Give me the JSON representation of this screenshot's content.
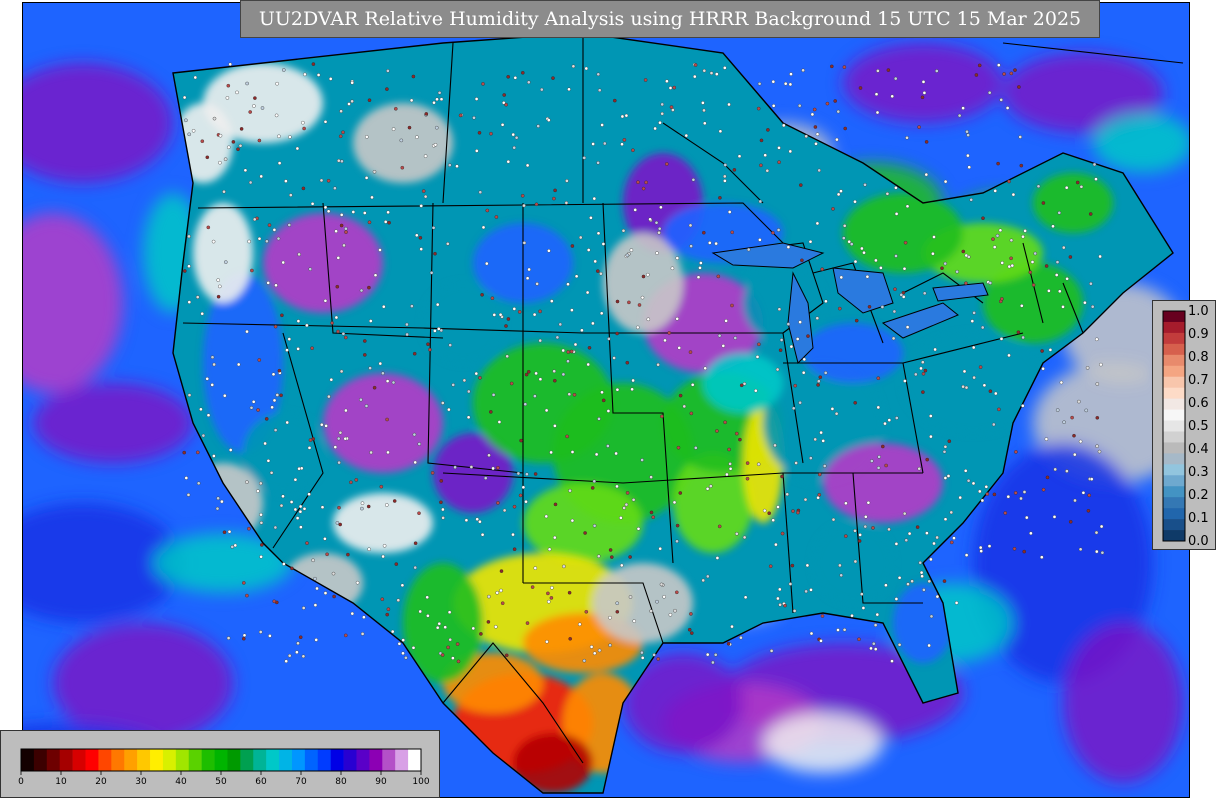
{
  "title": "UU2DVAR Relative Humidity Analysis using HRRR Background 15 UTC 15 Mar 2025",
  "rh_legend": {
    "labels": [
      "1.0",
      "0.9",
      "0.8",
      "0.7",
      "0.6",
      "0.5",
      "0.4",
      "0.3",
      "0.2",
      "0.1",
      "0.0"
    ],
    "colors": [
      "#67001f",
      "#a51c2c",
      "#c23c3c",
      "#d6604d",
      "#e88a6c",
      "#f4a582",
      "#f8c6ac",
      "#fddbc7",
      "#f2e8e4",
      "#f7f7f7",
      "#e6e6e6",
      "#d1d1d1",
      "#bababa",
      "#a6b9c8",
      "#92c5de",
      "#6ea9cf",
      "#4393c3",
      "#3478b4",
      "#2166ac",
      "#184f8a",
      "#0f3a68"
    ]
  },
  "humidity_legend": {
    "ticks": [
      "0",
      "10",
      "20",
      "30",
      "40",
      "50",
      "60",
      "70",
      "80",
      "90",
      "100"
    ],
    "colors": [
      "#140000",
      "#3c0000",
      "#6e0000",
      "#a50000",
      "#d70000",
      "#ff0000",
      "#ff4600",
      "#ff7800",
      "#ffa000",
      "#ffc800",
      "#ffee00",
      "#d8f000",
      "#a0e600",
      "#5ad200",
      "#1ebe00",
      "#00b400",
      "#009a00",
      "#00a050",
      "#00b496",
      "#00c8c8",
      "#00b4e6",
      "#0096ff",
      "#0064ff",
      "#003cff",
      "#0000e6",
      "#2800d2",
      "#5a00c8",
      "#8c00b4",
      "#b450c8",
      "#d8a0e6",
      "#ffffff"
    ]
  },
  "map": {
    "colors": {
      "ocean": "#1e64ff",
      "ocean_deep": "#1432e6",
      "purple": "#7814c8",
      "magenta": "#b43cc8",
      "grey": "#c8c8c8",
      "white": "#f0f0f0",
      "teal": "#0096b4",
      "cyan": "#00c8c8",
      "green": "#1ebe1e",
      "green_light": "#64dc14",
      "yellow": "#f0e600",
      "orange": "#ff8c00",
      "red": "#ff1e00",
      "darkred": "#b40000",
      "border": "#000000"
    }
  }
}
